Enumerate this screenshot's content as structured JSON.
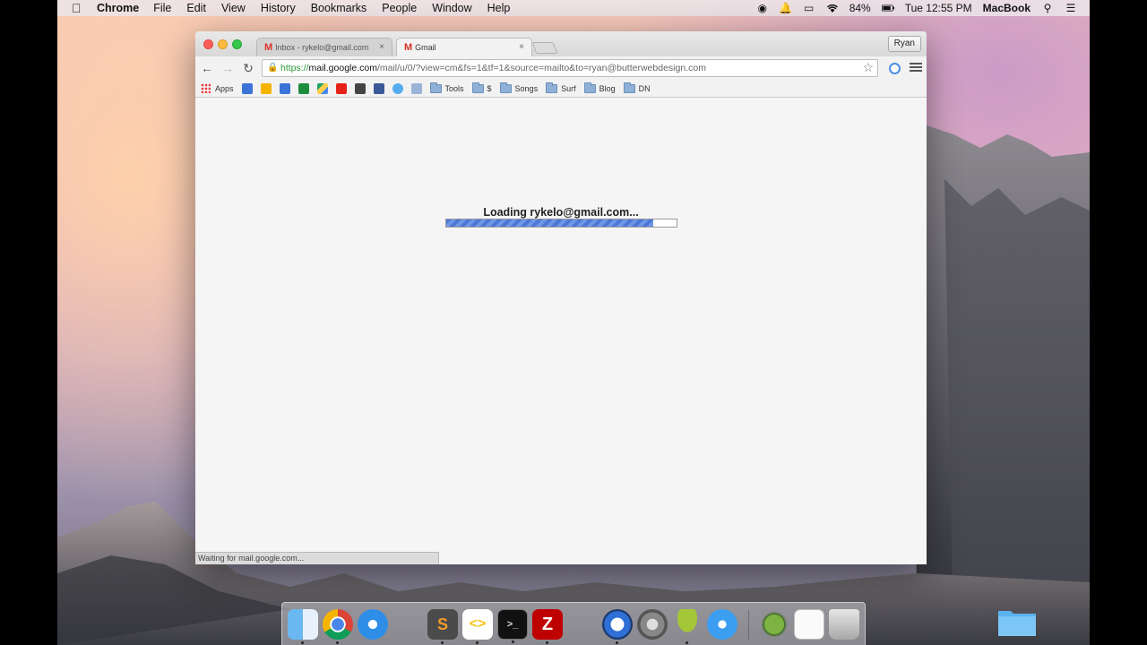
{
  "menubar": {
    "app_name": "Chrome",
    "items": [
      "File",
      "Edit",
      "View",
      "History",
      "Bookmarks",
      "People",
      "Window",
      "Help"
    ],
    "battery": "84%",
    "clock": "Tue 12:55 PM",
    "computer_name": "MacBook"
  },
  "browser": {
    "tabs": [
      {
        "title": "Inbox - rykelo@gmail.com",
        "favicon": "gmail-icon"
      },
      {
        "title": "Gmail",
        "favicon": "gmail-icon"
      }
    ],
    "profile_name": "Ryan",
    "url": {
      "scheme": "https://",
      "host": "mail.google.com",
      "path": "/mail/u/0/?view=cm&fs=1&tf=1&source=mailto&to=ryan@butterwebdesign.com"
    },
    "bookmarks": {
      "apps_label": "Apps",
      "folders": [
        "Tools",
        "$",
        "Songs",
        "Surf",
        "Blog",
        "DN"
      ]
    }
  },
  "page": {
    "loading_text": "Loading rykelo@gmail.com...",
    "progress": 0.9,
    "status_text": "Waiting for mail.google.com..."
  },
  "dock": {
    "apps": [
      "finder",
      "chrome",
      "safari",
      "sublime-text",
      "brackets",
      "terminal",
      "filezilla",
      "quicktime",
      "system-preferences",
      "android-studio",
      "app-store",
      "android-file-transfer",
      "preview",
      "trash"
    ]
  },
  "colors": {
    "progress_fill": "#4a78d6",
    "secure_green": "#2a9a3a",
    "gmail_red": "#d93025"
  }
}
